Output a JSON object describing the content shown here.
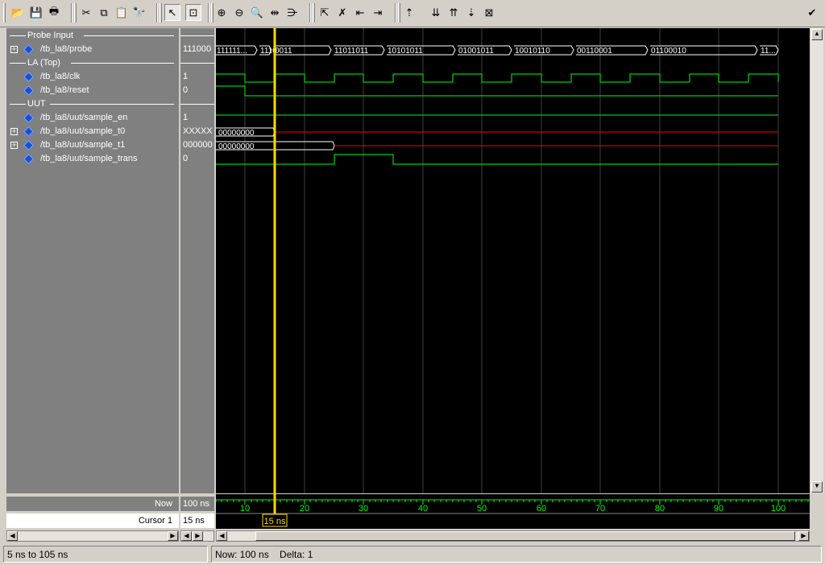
{
  "toolbar": {
    "buttons": [
      {
        "name": "open-icon",
        "glyph": "📂"
      },
      {
        "name": "save-icon",
        "glyph": "💾"
      },
      {
        "name": "print-icon",
        "glyph": "🖶"
      },
      {
        "name": "cut-icon",
        "glyph": "✂"
      },
      {
        "name": "copy-icon",
        "glyph": "⧉"
      },
      {
        "name": "paste-icon",
        "glyph": "📋"
      },
      {
        "name": "find-icon",
        "glyph": "🔭"
      },
      {
        "name": "select-mode-icon",
        "glyph": "↖"
      },
      {
        "name": "zoom-mode-icon",
        "glyph": "⊡"
      },
      {
        "name": "zoom-in-icon",
        "glyph": "⊕"
      },
      {
        "name": "zoom-out-icon",
        "glyph": "⊖"
      },
      {
        "name": "zoom-full-icon",
        "glyph": "🔍"
      },
      {
        "name": "zoom-cursor-icon",
        "glyph": "⇹"
      },
      {
        "name": "zoom-range-icon",
        "glyph": "⋺"
      },
      {
        "name": "add-cursor-icon",
        "glyph": "⇱"
      },
      {
        "name": "delete-cursor-icon",
        "glyph": "✗"
      },
      {
        "name": "previous-edge-icon",
        "glyph": "⇤"
      },
      {
        "name": "next-edge-icon",
        "glyph": "⇥"
      },
      {
        "name": "find-first-icon",
        "glyph": "⇡"
      },
      {
        "name": "find-prev-icon",
        "glyph": "⇊"
      },
      {
        "name": "find-next-icon",
        "glyph": "⇈"
      },
      {
        "name": "find-last-icon",
        "glyph": "⇣"
      },
      {
        "name": "clear-icon",
        "glyph": "⊠"
      },
      {
        "name": "dock-icon",
        "glyph": "✔"
      }
    ]
  },
  "signals": {
    "group_probe": "Probe Input",
    "probe": {
      "name": "/tb_la8/probe",
      "value": "111000"
    },
    "group_la": "LA (Top)",
    "clk": {
      "name": "/tb_la8/clk",
      "value": "1"
    },
    "reset": {
      "name": "/tb_la8/reset",
      "value": "0"
    },
    "group_uut": "UUT",
    "sample_en": {
      "name": "/tb_la8/uut/sample_en",
      "value": "1"
    },
    "sample_t0": {
      "name": "/tb_la8/uut/sample_t0",
      "value": "XXXXX"
    },
    "sample_t1": {
      "name": "/tb_la8/uut/sample_t1",
      "value": "000000"
    },
    "sample_trans": {
      "name": "/tb_la8/uut/sample_trans",
      "value": "0"
    }
  },
  "wave_labels": {
    "probe": [
      "111111...",
      "1110",
      "0011",
      "11011011",
      "10101011",
      "01001011",
      "10010110",
      "00110001",
      "01100010",
      "11..."
    ],
    "sample_t0": "00000000",
    "sample_t1": "00000000"
  },
  "timeline": {
    "range_start_ns": 5,
    "range_end_ns": 100,
    "ticks": [
      "10",
      "20",
      "30",
      "40",
      "50",
      "60",
      "70",
      "80",
      "90",
      "100"
    ],
    "tick_values": [
      10,
      20,
      30,
      40,
      50,
      60,
      70,
      80,
      90,
      100
    ],
    "cursor_ns": 15
  },
  "bottom": {
    "now_label": "Now",
    "now_value": "100 ns",
    "cursor_label": "Cursor 1",
    "cursor_value": "15 ns",
    "cursor_tag": "15 ns"
  },
  "status": {
    "range": "5 ns to 105 ns",
    "now": "Now: 100 ns",
    "delta": "Delta: 1"
  },
  "colors": {
    "wave_green": "#00ff00",
    "wave_red": "#ff0000",
    "cursor_yellow": "#ffd800",
    "grid": "#c0c0c0"
  }
}
